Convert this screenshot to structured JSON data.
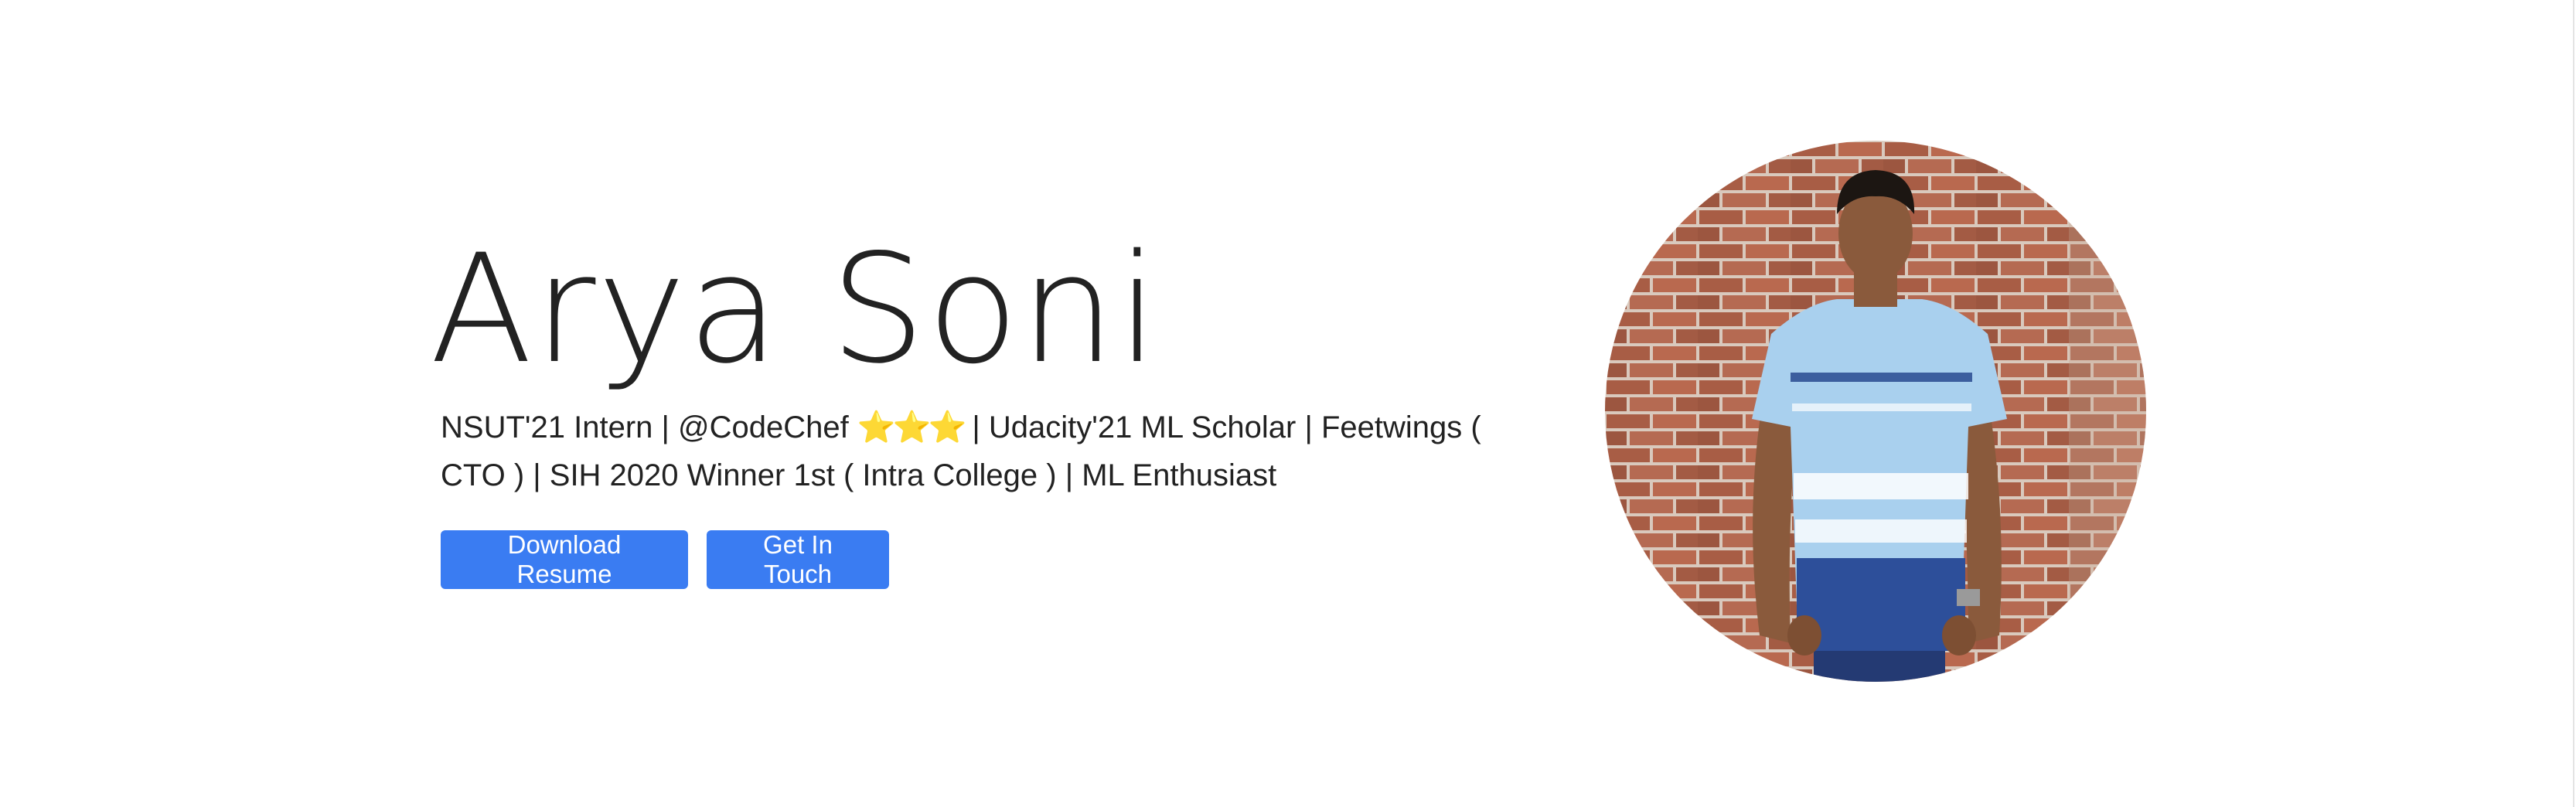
{
  "hero": {
    "name": "Arya Soni",
    "tagline": {
      "before_stars": "NSUT'21 Intern | @CodeChef ",
      "stars": "⭐⭐⭐",
      "after_stars": " | Udacity'21 ML Scholar | Feetwings ( CTO ) | SIH 2020 Winner 1st ( Intra College ) | ML Enthusiast"
    },
    "buttons": {
      "resume_label": "Download Resume",
      "contact_label": "Get In Touch"
    },
    "avatar_icon": "profile-photo",
    "colors": {
      "button": "#3a7cf2",
      "text": "#222222",
      "brick": "#a85d45",
      "shirt": "#a9d0ee",
      "shirt_stripe": "#2d4f9a"
    }
  }
}
